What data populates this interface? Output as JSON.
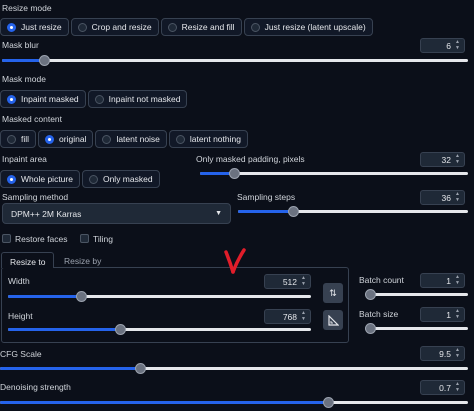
{
  "resize_mode": {
    "label": "Resize mode",
    "options": [
      "Just resize",
      "Crop and resize",
      "Resize and fill",
      "Just resize (latent upscale)"
    ],
    "selected": "Just resize"
  },
  "mask_blur": {
    "label": "Mask blur",
    "value": "6",
    "fraction": 0.09
  },
  "mask_mode": {
    "label": "Mask mode",
    "options": [
      "Inpaint masked",
      "Inpaint not masked"
    ],
    "selected": "Inpaint masked"
  },
  "masked_content": {
    "label": "Masked content",
    "options": [
      "fill",
      "original",
      "latent noise",
      "latent nothing"
    ],
    "selected": "original"
  },
  "inpaint_area": {
    "label": "Inpaint area",
    "options": [
      "Whole picture",
      "Only masked"
    ],
    "selected": "Whole picture"
  },
  "only_masked_padding": {
    "label": "Only masked padding, pixels",
    "value": "32",
    "fraction": 0.125
  },
  "sampling_method": {
    "label": "Sampling method",
    "value": "DPM++ 2M Karras"
  },
  "sampling_steps": {
    "label": "Sampling steps",
    "value": "36",
    "fraction": 0.24
  },
  "restore_faces": {
    "label": "Restore faces"
  },
  "tiling": {
    "label": "Tiling"
  },
  "resize_tabs": {
    "resize_to": "Resize to",
    "resize_by": "Resize by"
  },
  "width": {
    "label": "Width",
    "value": "512",
    "fraction": 0.24
  },
  "height": {
    "label": "Height",
    "value": "768",
    "fraction": 0.37
  },
  "batch_count": {
    "label": "Batch count",
    "value": "1",
    "fraction": 0.0
  },
  "batch_size": {
    "label": "Batch size",
    "value": "1",
    "fraction": 0.0
  },
  "cfg_scale": {
    "label": "CFG Scale",
    "value": "9.5",
    "fraction": 0.3
  },
  "denoising_strength": {
    "label": "Denoising strength",
    "value": "0.7",
    "fraction": 0.7
  },
  "icons": {
    "swap": "swap-dimensions-icon",
    "ratio": "aspect-ratio-icon",
    "arrow": "red-arrow-annotation"
  },
  "colors": {
    "accent": "#2563eb",
    "background": "#0b0f19",
    "annotation": "#e11d2a"
  }
}
